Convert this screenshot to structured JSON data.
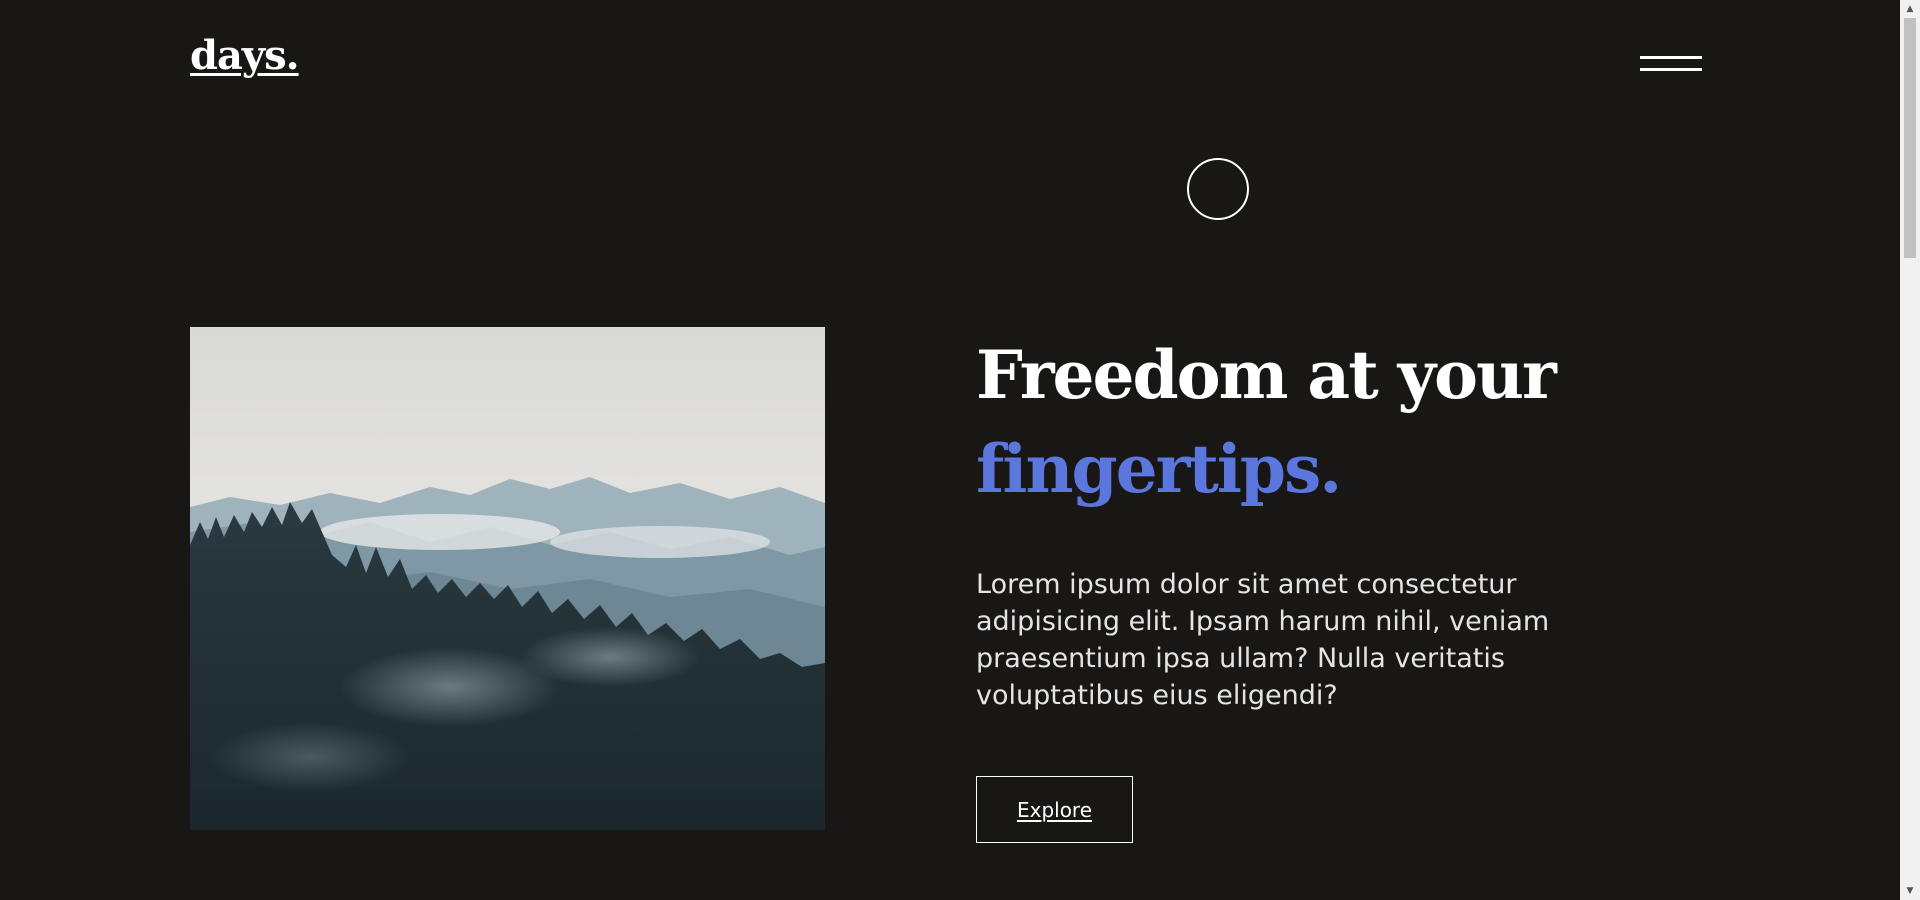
{
  "header": {
    "logo_text": "days."
  },
  "hero": {
    "heading_line1": "Freedom at your",
    "heading_line2": "fingertips.",
    "description": "Lorem ipsum dolor sit amet consectetur adipisicing elit. Ipsam harum nihil, veniam praesentium ipsa ullam? Nulla veritatis voluptatibus eius eligendi?",
    "cta_label": "Explore"
  },
  "icons": {
    "menu": "hamburger-menu-icon",
    "cursor": "cursor-circle-icon",
    "scroll_up": "scroll-up-arrow-icon",
    "scroll_down": "scroll-down-arrow-icon"
  },
  "colors": {
    "background": "#181716",
    "text": "#ffffff",
    "accent": "#5b77dd",
    "body_text": "#e4e4e4"
  }
}
